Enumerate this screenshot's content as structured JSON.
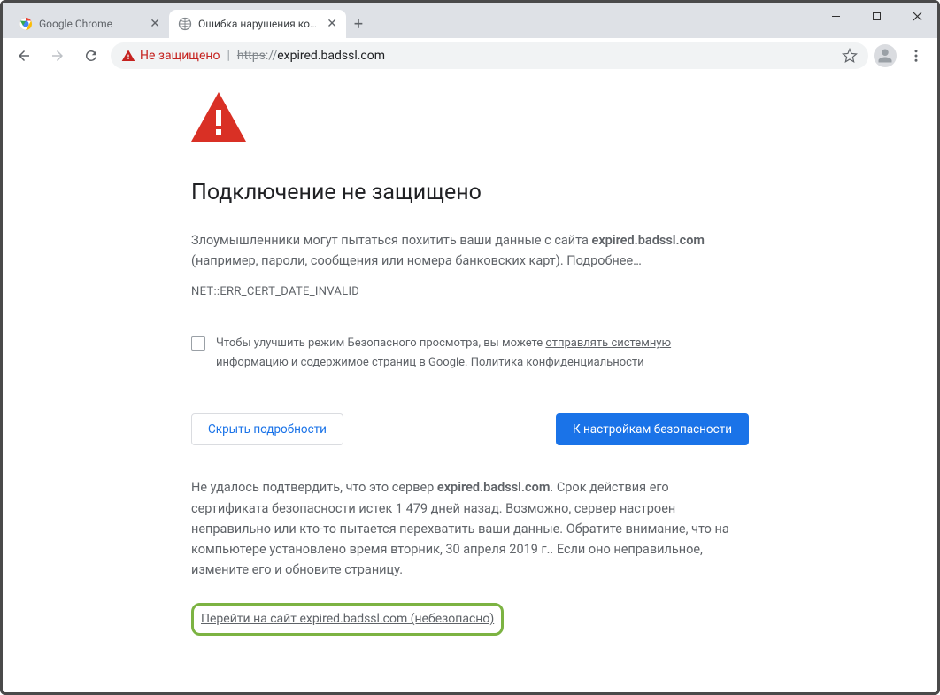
{
  "window": {
    "tabs": [
      {
        "title": "Google Chrome",
        "active": false
      },
      {
        "title": "Ошибка нарушения конфиденц",
        "active": true
      }
    ]
  },
  "toolbar": {
    "secure_label": "Не защищено",
    "url_https": "https",
    "url_sep": "://",
    "url_host": "expired.badssl.com"
  },
  "page": {
    "heading": "Подключение не защищено",
    "warn_prefix": "Злоумышленники могут пытаться похитить ваши данные с сайта ",
    "warn_host": "expired.badssl.com",
    "warn_suffix": " (например, пароли, сообщения или номера банковских карт). ",
    "learn_more": "Подробнее…",
    "error_code": "NET::ERR_CERT_DATE_INVALID",
    "optin_1": "Чтобы улучшить режим Безопасного просмотра, вы можете ",
    "optin_link1": "отправлять системную информацию и содержимое страниц",
    "optin_2": " в Google. ",
    "optin_link2": "Политика конфиденциальности",
    "btn_hide": "Скрыть подробности",
    "btn_safety": "К настройкам безопасности",
    "explain_1": "Не удалось подтвердить, что это сервер ",
    "explain_host": "expired.badssl.com",
    "explain_2": ". Срок действия его сертификата безопасности истек 1 479 дней назад. Возможно, сервер настроен неправильно или кто-то пытается перехватить ваши данные. Обратите внимание, что на компьютере установлено время вторник, 30 апреля 2019 г.. Если оно неправильное, измените его и обновите страницу.",
    "proceed": "Перейти на сайт expired.badssl.com (небезопасно)"
  }
}
